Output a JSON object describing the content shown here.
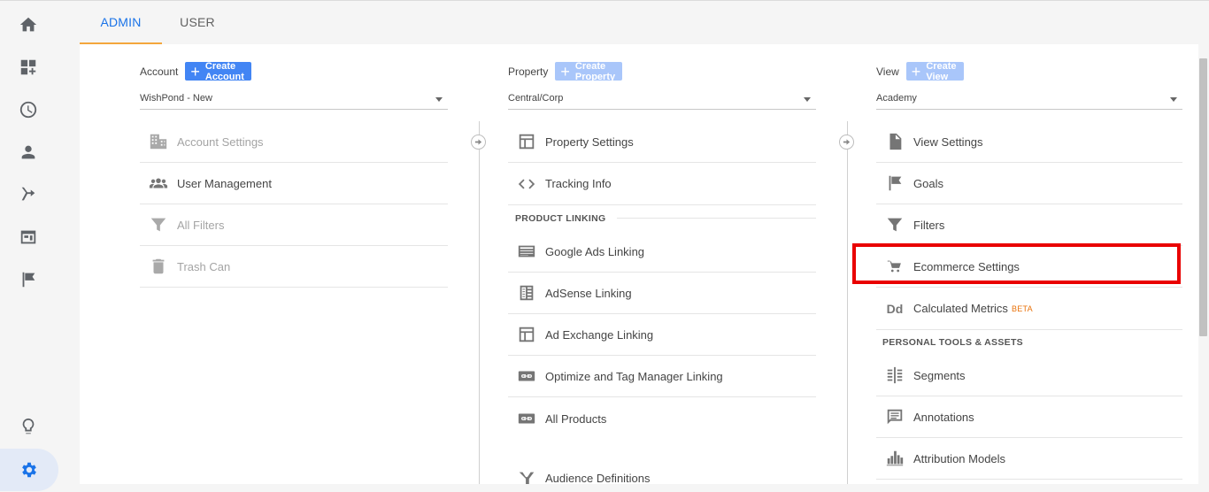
{
  "tabs": {
    "admin": "ADMIN",
    "user": "USER"
  },
  "account": {
    "label": "Account",
    "create_label": "Create Account",
    "selected": "WishPond - New",
    "items": [
      "Account Settings",
      "User Management",
      "All Filters",
      "Trash Can"
    ]
  },
  "property": {
    "label": "Property",
    "create_label": "Create Property",
    "selected": "Central/Corp",
    "items": [
      "Property Settings",
      "Tracking Info"
    ],
    "section": "PRODUCT LINKING",
    "linking": [
      "Google Ads Linking",
      "AdSense Linking",
      "Ad Exchange Linking",
      "Optimize and Tag Manager Linking",
      "All Products"
    ],
    "audience": "Audience Definitions"
  },
  "view": {
    "label": "View",
    "create_label": "Create View",
    "selected": "Academy",
    "items": [
      "View Settings",
      "Goals",
      "Filters",
      "Ecommerce Settings",
      "Calculated Metrics"
    ],
    "beta": "BETA",
    "dd_icon_text": "Dd",
    "section": "PERSONAL TOOLS & ASSETS",
    "tools": [
      "Segments",
      "Annotations",
      "Attribution Models"
    ]
  },
  "colors": {
    "accent": "#1a73e8",
    "tab_indicator": "#f4a63c",
    "highlight": "#e90000",
    "button": "#4285f4"
  },
  "icons": {
    "nav": [
      "home-icon",
      "dashboard-icon",
      "clock-icon",
      "person-icon",
      "acquisition-icon",
      "behavior-icon",
      "flag-icon",
      "lightbulb-icon",
      "gear-icon"
    ]
  }
}
